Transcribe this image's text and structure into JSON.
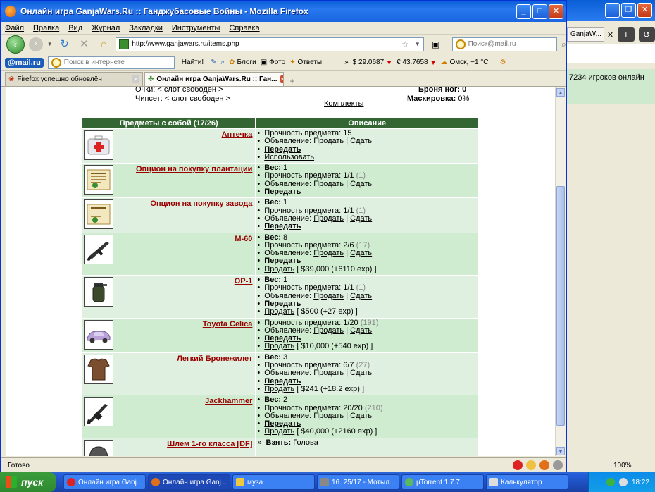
{
  "window": {
    "title": "Онлайн игра GanjaWars.Ru :: Ганджубасовые Войны - Mozilla Firefox"
  },
  "menu": [
    "Файл",
    "Правка",
    "Вид",
    "Журнал",
    "Закладки",
    "Инструменты",
    "Справка"
  ],
  "nav": {
    "url": "http://www.ganjawars.ru/items.php",
    "search_placeholder": "Поиск@mail.ru"
  },
  "mailbar": {
    "logo": "@mail.ru",
    "search_placeholder": "Поиск в интернете",
    "find": "Найти!",
    "blogs": "Блоги",
    "photo": "Фото",
    "answers": "Ответы",
    "usd": "$ 29.0687",
    "eur": "€ 43.7658",
    "weather": "Омск, −1 °C"
  },
  "tabs": [
    {
      "label": "Firefox успешно обновлён"
    },
    {
      "label": "Онлайн игра GanjaWars.Ru :: Ган..."
    }
  ],
  "bg_window": {
    "tab": "GanjaW...",
    "online": "7234 игроков онлайн"
  },
  "top_info": {
    "left1": "Очки: < слот свободен >",
    "left2": "Чипсет: < слот свободен >",
    "right1": "Броня ног: 0",
    "right2_label": "Маскировка:",
    "right2_value": "0%",
    "sets_link": "Комплекты"
  },
  "table": {
    "headers": [
      "Предметы с собой (17/26)",
      "Описание"
    ],
    "rows": [
      {
        "name": "Аптечка",
        "icon": "first-aid-kit",
        "desc": [
          {
            "t": "Прочность предмета: 15"
          },
          {
            "t": "Объявление:",
            "links": [
              "Продать",
              "Сдать"
            ]
          },
          {
            "t": "Передать",
            "bold": true,
            "link": true
          },
          {
            "t": "Использовать",
            "link": true
          }
        ]
      },
      {
        "name": "Опцион на покупку плантации",
        "icon": "document",
        "desc": [
          {
            "t": "Вес:",
            "v": "1",
            "boldlabel": true
          },
          {
            "t": "Прочность предмета: 1/1",
            "g": "(1)"
          },
          {
            "t": "Объявление:",
            "links": [
              "Продать",
              "Сдать"
            ]
          },
          {
            "t": "Передать",
            "bold": true,
            "link": true
          }
        ]
      },
      {
        "name": "Опцион на покупку завода",
        "icon": "document",
        "desc": [
          {
            "t": "Вес:",
            "v": "1",
            "boldlabel": true
          },
          {
            "t": "Прочность предмета: 1/1",
            "g": "(1)"
          },
          {
            "t": "Объявление:",
            "links": [
              "Продать",
              "Сдать"
            ]
          },
          {
            "t": "Передать",
            "bold": true,
            "link": true
          }
        ]
      },
      {
        "name": "M-60",
        "icon": "machine-gun",
        "desc": [
          {
            "t": "Вес:",
            "v": "8",
            "boldlabel": true
          },
          {
            "t": "Прочность предмета: 2/6",
            "g": "(17)"
          },
          {
            "t": "Объявление:",
            "links": [
              "Продать",
              "Сдать"
            ]
          },
          {
            "t": "Передать",
            "bold": true,
            "link": true
          },
          {
            "t": "Продать",
            "link": true,
            "after": "[ $39,000 (+6110 exp) ]"
          }
        ]
      },
      {
        "name": "ОР-1",
        "icon": "grenade",
        "desc": [
          {
            "t": "Вес:",
            "v": "1",
            "boldlabel": true
          },
          {
            "t": "Прочность предмета: 1/1",
            "g": "(1)"
          },
          {
            "t": "Объявление:",
            "links": [
              "Продать",
              "Сдать"
            ]
          },
          {
            "t": "Передать",
            "bold": true,
            "link": true
          },
          {
            "t": "Продать",
            "link": true,
            "after": "[ $500 (+27 exp) ]"
          }
        ]
      },
      {
        "name": "Toyota Celica",
        "icon": "car",
        "desc": [
          {
            "t": "Прочность предмета: 1/20",
            "g": "(191)"
          },
          {
            "t": "Объявление:",
            "links": [
              "Продать",
              "Сдать"
            ]
          },
          {
            "t": "Передать",
            "bold": true,
            "link": true
          },
          {
            "t": "Продать",
            "link": true,
            "after": "[ $10,000 (+540 exp) ]"
          }
        ]
      },
      {
        "name": "Легкий Бронежилет",
        "icon": "body-armor",
        "desc": [
          {
            "t": "Вес:",
            "v": "3",
            "boldlabel": true
          },
          {
            "t": "Прочность предмета: 6/7",
            "g": "(27)"
          },
          {
            "t": "Объявление:",
            "links": [
              "Продать",
              "Сдать"
            ]
          },
          {
            "t": "Передать",
            "bold": true,
            "link": true
          },
          {
            "t": "Продать",
            "link": true,
            "after": "[ $241 (+18.2 exp) ]"
          }
        ]
      },
      {
        "name": "Jackhammer",
        "icon": "shotgun",
        "desc": [
          {
            "t": "Вес:",
            "v": "2",
            "boldlabel": true
          },
          {
            "t": "Прочность предмета: 20/20",
            "g": "(210)"
          },
          {
            "t": "Объявление:",
            "links": [
              "Продать",
              "Сдать"
            ]
          },
          {
            "t": "Передать",
            "bold": true,
            "link": true
          },
          {
            "t": "Продать",
            "link": true,
            "after": "[ $40,000 (+2160 exp) ]"
          }
        ]
      },
      {
        "name": "Шлем 1-го класса [DF]",
        "icon": "helmet",
        "desc": [
          {
            "t": "Взять:",
            "v": "Голова",
            "boldlabel": true,
            "arrow": true
          }
        ]
      }
    ]
  },
  "status": "Готово",
  "taskbar": {
    "start": "пуск",
    "tasks": [
      "Онлайн игра Ganj...",
      "Онлайн игра Ganj...",
      "муза",
      "16. 25/17 - Мотыл...",
      "µTorrent 1.7.7",
      "Калькулятор"
    ],
    "zoom": "100%",
    "clock": "18:22"
  },
  "colors": {
    "header_green": "#336633",
    "item_link": "#990000",
    "row_light": "#e0f0e0",
    "row_dark": "#d0ecd0"
  }
}
